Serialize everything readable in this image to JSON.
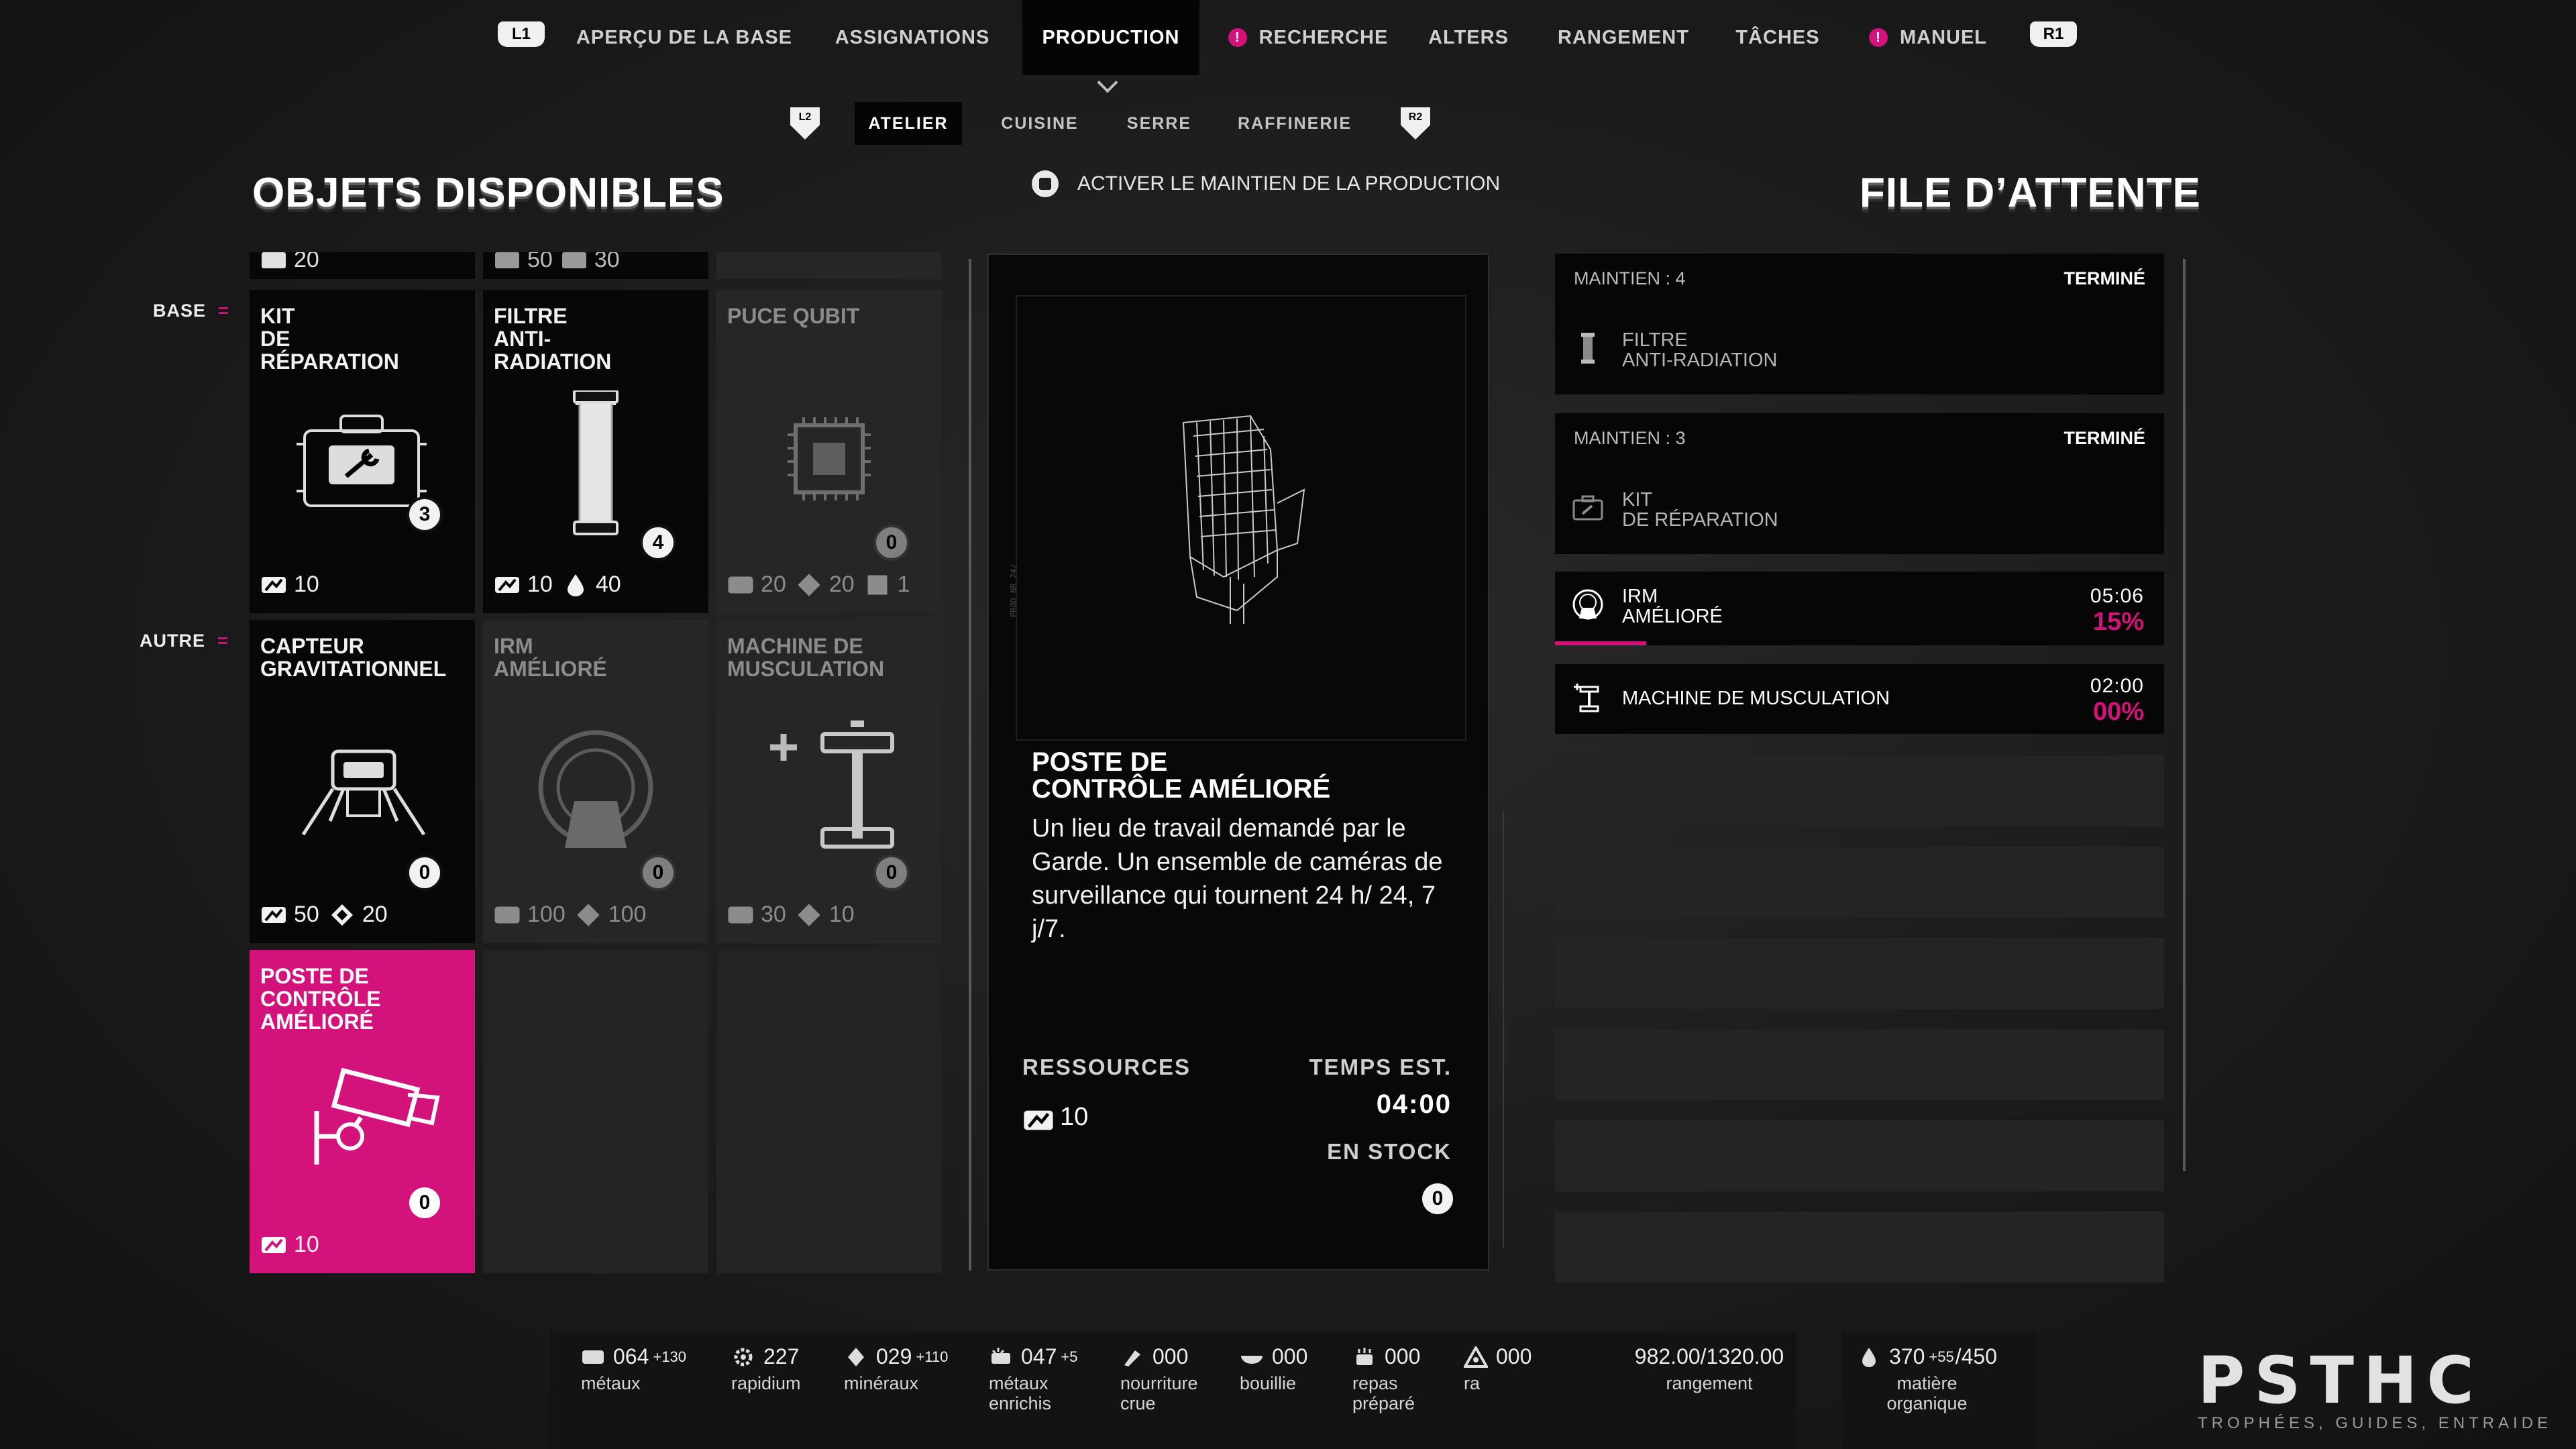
{
  "top_nav": {
    "l1": "L1",
    "r1": "R1",
    "items": [
      {
        "label": "APERÇU DE LA BASE",
        "alert": false
      },
      {
        "label": "ASSIGNATIONS",
        "alert": false
      },
      {
        "label": "PRODUCTION",
        "alert": false,
        "active": true
      },
      {
        "label": "RECHERCHE",
        "alert": true
      },
      {
        "label": "ALTERS",
        "alert": false
      },
      {
        "label": "RANGEMENT",
        "alert": false
      },
      {
        "label": "TÂCHES",
        "alert": false
      },
      {
        "label": "MANUEL",
        "alert": true
      }
    ],
    "alert_color": "#d3127c"
  },
  "sub_nav": {
    "l2": "L2",
    "r2": "R2",
    "tabs": [
      "ATELIER",
      "CUISINE",
      "SERRE",
      "RAFFINERIE"
    ],
    "active": "ATELIER"
  },
  "maintain_toggle": "ACTIVER LE MAINTIEN DE LA PRODUCTION",
  "left": {
    "title": "OBJETS DISPONIBLES",
    "partial_row": [
      {
        "costs": [
          "20"
        ]
      },
      {
        "costs": [
          "50",
          "30"
        ]
      }
    ],
    "categories": [
      {
        "label": "BASE",
        "items": [
          {
            "name": "KIT\nDE\nRÉPARATION",
            "count": "3",
            "costs": [
              {
                "icon": "metal-icon",
                "value": "10"
              }
            ],
            "state": "available"
          },
          {
            "name": "FILTRE\nANTI-\nRADIATION",
            "count": "4",
            "costs": [
              {
                "icon": "metal-icon",
                "value": "10"
              },
              {
                "icon": "water-icon",
                "value": "40"
              }
            ],
            "state": "available"
          },
          {
            "name": "PUCE QUBIT",
            "count": "0",
            "costs": [
              {
                "icon": "metal-icon",
                "value": "20"
              },
              {
                "icon": "mineral-icon",
                "value": "20"
              },
              {
                "icon": "chip-icon",
                "value": "1"
              }
            ],
            "state": "locked"
          }
        ]
      },
      {
        "label": "AUTRE",
        "items": [
          {
            "name": "CAPTEUR\nGRAVITATIONNEL",
            "count": "0",
            "costs": [
              {
                "icon": "metal-icon",
                "value": "50"
              },
              {
                "icon": "mineral-icon",
                "value": "20"
              }
            ],
            "state": "available"
          },
          {
            "name": "IRM\nAMÉLIORÉ",
            "count": "0",
            "costs": [
              {
                "icon": "metal-icon",
                "value": "100"
              },
              {
                "icon": "mineral-icon",
                "value": "100"
              }
            ],
            "state": "locked"
          },
          {
            "name": "MACHINE DE\nMUSCULATION",
            "count": "0",
            "costs": [
              {
                "icon": "metal-icon",
                "value": "30"
              },
              {
                "icon": "mineral-icon",
                "value": "10"
              }
            ],
            "state": "locked"
          }
        ]
      }
    ],
    "selected_item": {
      "name": "POSTE DE\nCONTRÔLE\nAMÉLIORÉ",
      "count": "0",
      "costs": [
        {
          "icon": "metal-icon",
          "value": "10"
        }
      ]
    }
  },
  "detail": {
    "name": "POSTE DE\nCONTRÔLE AMÉLIORÉ",
    "description": "Un lieu de travail demandé par le Garde. Un ensemble de caméras de surveillance qui tournent 24 h/ 24, 7 j/7.",
    "resources_label": "RESSOURCES",
    "resources_value": "10",
    "time_label": "TEMPS EST.",
    "time_value": "04:00",
    "stock_label": "EN STOCK",
    "stock_value": "0",
    "blueprint_text": "PROD_NR_24/"
  },
  "queue": {
    "title": "FILE D’ATTENTE",
    "items": [
      {
        "maintain": "MAINTIEN : 4",
        "status": "TERMINÉ",
        "name": "FILTRE\nANTI-RADIATION",
        "icon": "filter-icon"
      },
      {
        "maintain": "MAINTIEN : 3",
        "status": "TERMINÉ",
        "name": "KIT\nDE RÉPARATION",
        "icon": "toolkit-icon"
      },
      {
        "name": "IRM\nAMÉLIORÉ",
        "time": "05:06",
        "percent": "15%",
        "progress": 0.15,
        "icon": "mri-icon"
      },
      {
        "name": "MACHINE DE MUSCULATION",
        "time": "02:00",
        "percent": "00%",
        "progress": 0.0,
        "icon": "dumbbell-icon"
      }
    ]
  },
  "resources_bar": [
    {
      "value": "064",
      "delta": "+130",
      "label": "métaux",
      "icon": "metal-icon"
    },
    {
      "value": "227",
      "delta": "",
      "label": "rapidium",
      "icon": "gear-icon"
    },
    {
      "value": "029",
      "delta": "+110",
      "label": "minéraux",
      "icon": "mineral-icon"
    },
    {
      "value": "047",
      "delta": "+5",
      "label": "métaux\nenrichis",
      "icon": "enriched-metal-icon"
    },
    {
      "value": "000",
      "delta": "",
      "label": "nourriture\ncrue",
      "icon": "raw-food-icon"
    },
    {
      "value": "000",
      "delta": "",
      "label": "bouillie",
      "icon": "porridge-icon"
    },
    {
      "value": "000",
      "delta": "",
      "label": "repas\npréparé",
      "icon": "meal-icon"
    },
    {
      "value": "000",
      "delta": "",
      "label": "ra",
      "icon": "ra-icon"
    }
  ],
  "storage": {
    "value": "982.00/1320.00",
    "label": "rangement"
  },
  "organic": {
    "value": "370",
    "delta": "+55",
    "max": "/450",
    "label": "matière\norganique",
    "icon": "water-icon"
  },
  "watermark": {
    "mark": "PSTHC",
    "tagline": "TROPHÉES, GUIDES, ENTRAIDE"
  }
}
